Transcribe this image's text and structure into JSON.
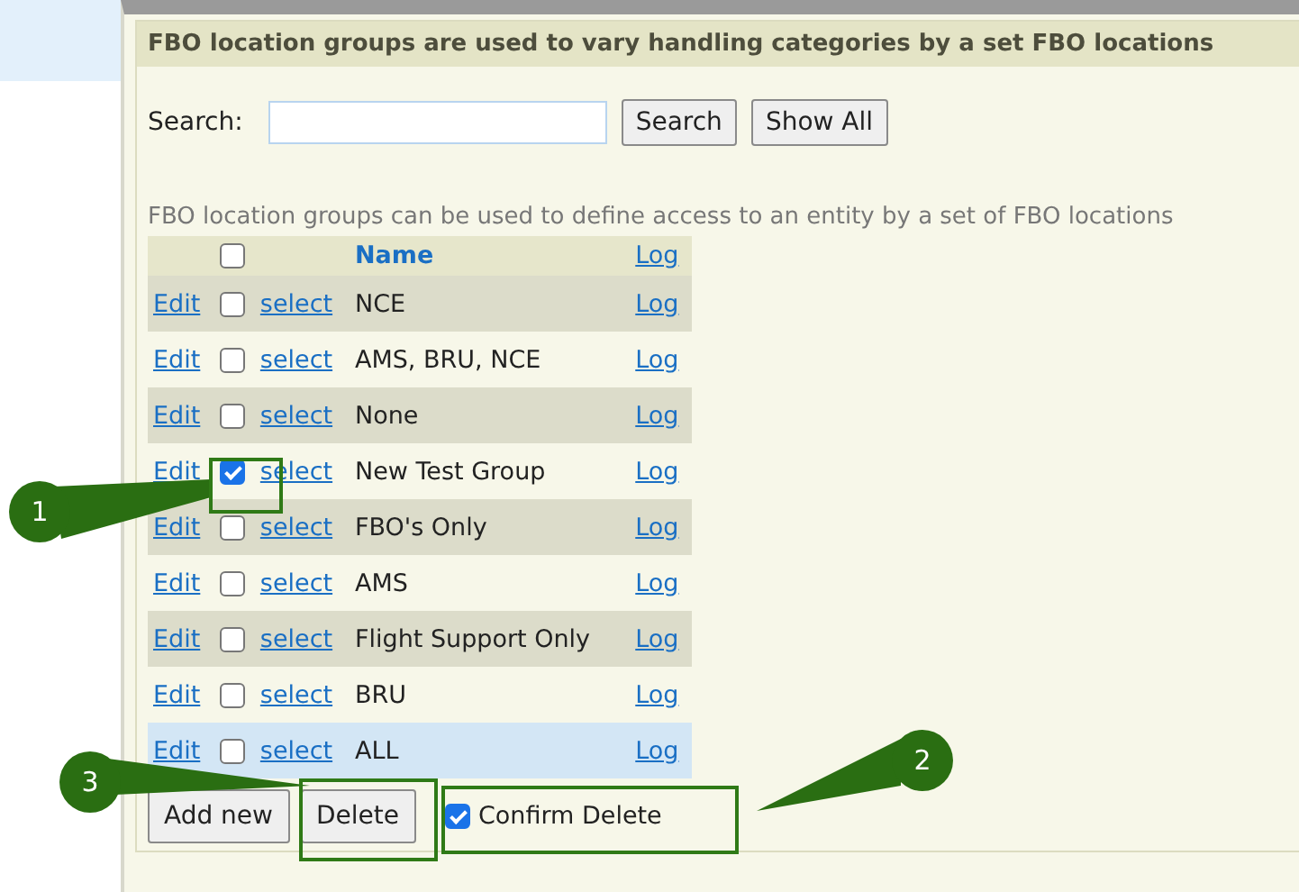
{
  "panel": {
    "title": "FBO location groups are used to vary handling categories by a set FBO locations"
  },
  "search": {
    "label": "Search:",
    "buttons": [
      "Search",
      "Show All"
    ]
  },
  "description": "FBO location groups can be used to define access to an entity by a set of FBO locations",
  "table": {
    "header": {
      "checked": false,
      "name": "Name",
      "log": "Log"
    },
    "rows": [
      {
        "edit": "Edit",
        "checked": false,
        "select": "select",
        "name": "NCE",
        "log": "Log",
        "highlighted": false
      },
      {
        "edit": "Edit",
        "checked": false,
        "select": "select",
        "name": "AMS, BRU, NCE",
        "log": "Log",
        "highlighted": false
      },
      {
        "edit": "Edit",
        "checked": false,
        "select": "select",
        "name": "None",
        "log": "Log",
        "highlighted": false
      },
      {
        "edit": "Edit",
        "checked": true,
        "select": "select",
        "name": "New Test Group",
        "log": "Log",
        "highlighted": false
      },
      {
        "edit": "Edit",
        "checked": false,
        "select": "select",
        "name": "FBO's Only",
        "log": "Log",
        "highlighted": false
      },
      {
        "edit": "Edit",
        "checked": false,
        "select": "select",
        "name": "AMS",
        "log": "Log",
        "highlighted": false
      },
      {
        "edit": "Edit",
        "checked": false,
        "select": "select",
        "name": "Flight Support Only",
        "log": "Log",
        "highlighted": false
      },
      {
        "edit": "Edit",
        "checked": false,
        "select": "select",
        "name": "BRU",
        "log": "Log",
        "highlighted": false
      },
      {
        "edit": "Edit",
        "checked": false,
        "select": "select",
        "name": "ALL",
        "log": "Log",
        "highlighted": true
      }
    ]
  },
  "actions": {
    "add": "Add new",
    "delete": "Delete",
    "confirm": {
      "label": "Confirm Delete",
      "checked": true
    }
  },
  "callouts": [
    {
      "label": "1"
    },
    {
      "label": "2"
    },
    {
      "label": "3"
    }
  ]
}
